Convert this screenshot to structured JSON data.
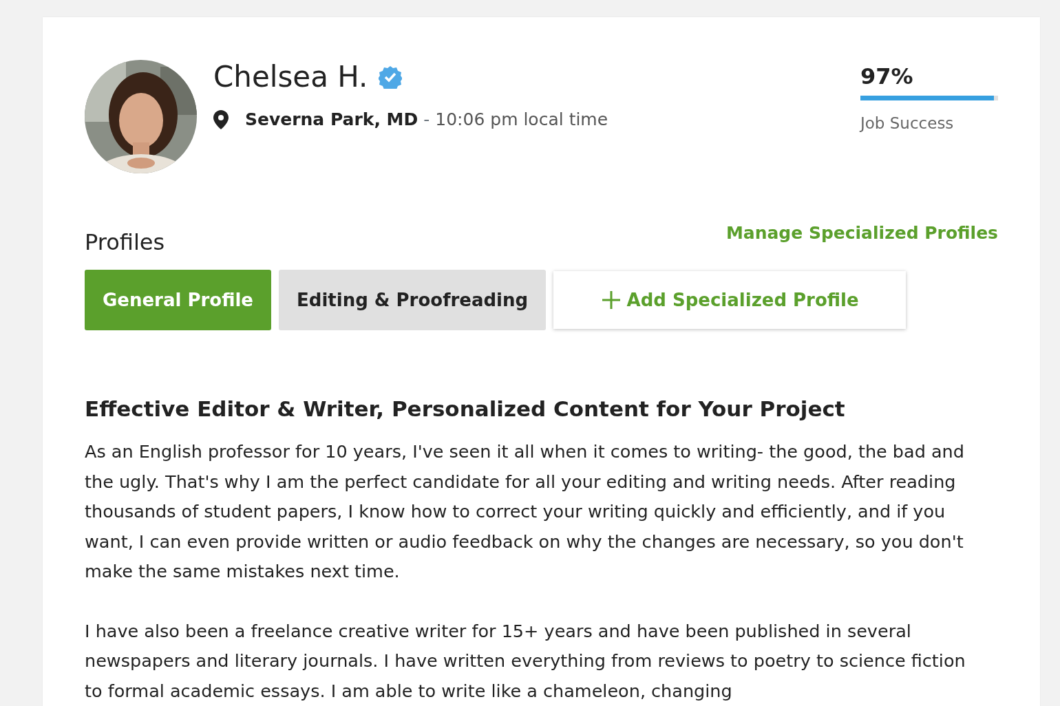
{
  "profile": {
    "name": "Chelsea H.",
    "verified": true,
    "location": "Severna Park, MD",
    "separator": "-",
    "local_time": "10:06 pm local time"
  },
  "job_success": {
    "value": "97%",
    "level": 0.97,
    "label": "Job Success"
  },
  "profiles": {
    "heading": "Profiles",
    "manage_link": "Manage Specialized Profiles",
    "tabs": [
      {
        "label": "General Profile",
        "selected": true
      },
      {
        "label": "Editing & Proofreading",
        "selected": false
      }
    ],
    "add_button": "Add Specialized Profile"
  },
  "overview": {
    "title": "Effective Editor & Writer, Personalized Content for Your Project",
    "paragraphs": [
      "As an English professor for 10 years, I've seen it all when it comes to writing- the good, the bad and the ugly. That's why I am the perfect candidate for all your editing and writing needs. After reading thousands of student papers, I know how to correct your writing quickly and efficiently, and if you want, I can even provide written or audio feedback on why the changes are necessary, so you don't make the same mistakes next time.",
      "I have also been a freelance creative writer for 15+ years and have been published in several newspapers and literary journals. I have written everything from reviews to poetry to science fiction to formal academic essays. I am able to write like a chameleon, changing"
    ]
  }
}
